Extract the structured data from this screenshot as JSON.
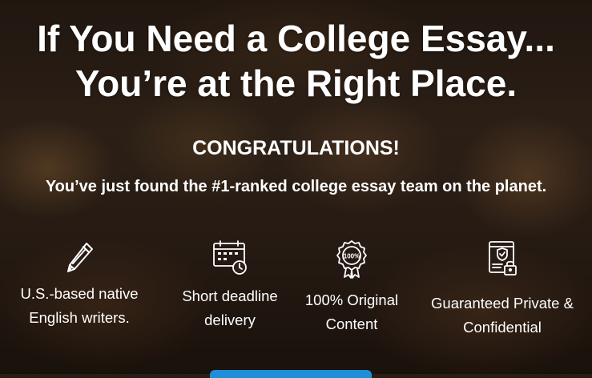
{
  "hero": {
    "headline_line1": "If You Need a College Essay...",
    "headline_line2": "You’re at the Right Place.",
    "congrats": "CONGRATULATIONS!",
    "subline": "You’ve just found the #1-ranked college essay team on the planet."
  },
  "features": [
    {
      "icon": "pen-icon",
      "line1": "U.S.-based native",
      "line2": "English writers."
    },
    {
      "icon": "calendar-clock-icon",
      "line1": "Short deadline",
      "line2": "delivery"
    },
    {
      "icon": "badge-100-icon",
      "badge_text": "100%",
      "line1": "100% Original",
      "line2": "Content"
    },
    {
      "icon": "secure-document-icon",
      "line1": "Guaranteed Private &",
      "line2": "Confidential"
    }
  ],
  "colors": {
    "text": "#ffffff",
    "cta": "#1f8ed8",
    "background": "#2a1d15"
  }
}
